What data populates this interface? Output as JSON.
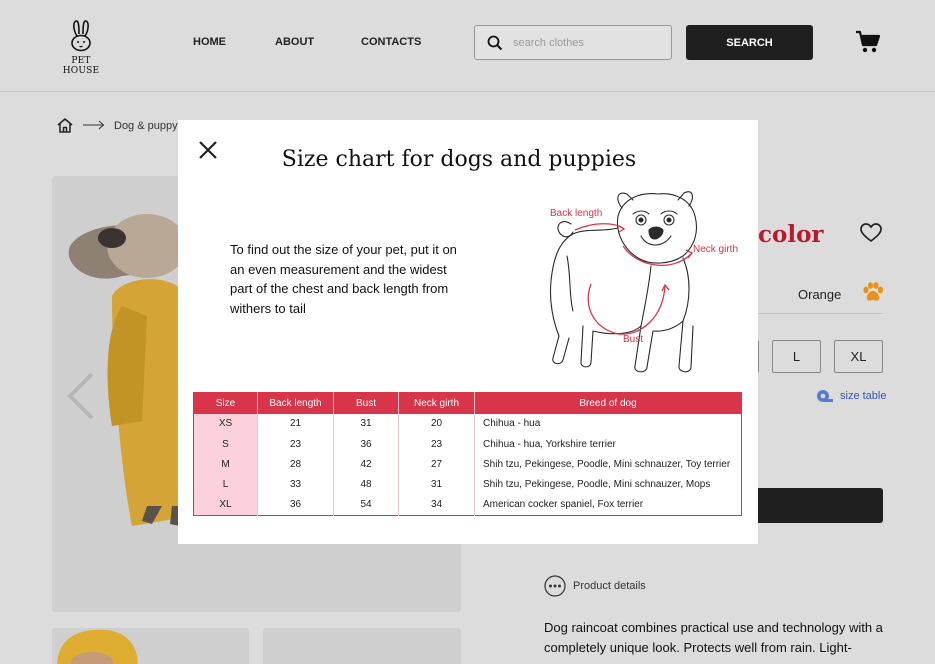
{
  "header": {
    "logo_text": "PET HOUSE",
    "nav": [
      "HOME",
      "ABOUT",
      "CONTACTS"
    ],
    "search_placeholder": "search clothes",
    "search_button": "SEARCH"
  },
  "breadcrumb": {
    "current": "Dog & puppy"
  },
  "product": {
    "color_title_fragment": "color",
    "color_name": "Orange",
    "sizes": [
      "L",
      "XL"
    ],
    "size_table_link": "size table",
    "details_label": "Product details",
    "description": "Dog raincoat combines practical use and technology with a completely unique look. Protects well from rain. Light-"
  },
  "modal": {
    "title": "Size chart for dogs and puppies",
    "text": "To find out the size of your pet, put it on an even measurement and the widest part of the chest and back length from withers to tail",
    "diagram_labels": {
      "back": "Back length",
      "neck": "Neck girth",
      "bust": "Bust"
    },
    "table": {
      "headers": [
        "Size",
        "Back length",
        "Bust",
        "Neck girth",
        "Breed of dog"
      ],
      "rows": [
        [
          "XS",
          "21",
          "31",
          "20",
          "Chihua - hua"
        ],
        [
          "S",
          "23",
          "36",
          "23",
          "Chihua - hua, Yorkshire terrier"
        ],
        [
          "M",
          "28",
          "42",
          "27",
          "Shih tzu, Pekingese, Poodle, Mini schnauzer, Toy terrier"
        ],
        [
          "L",
          "33",
          "48",
          "31",
          "Shih tzu, Pekingese, Poodle, Mini schnauzer, Mops"
        ],
        [
          "XL",
          "36",
          "54",
          "34",
          "American cocker spaniel, Fox terrier"
        ]
      ]
    }
  },
  "colors": {
    "accent": "#d8344a",
    "title_red": "#b8192e",
    "dark": "#1f1f1f",
    "overlay_bg": "#dcdcdc"
  },
  "icons": [
    "rabbit-logo-icon",
    "search-icon",
    "cart-icon",
    "home-icon",
    "arrow-right-icon",
    "chevron-left-icon",
    "heart-icon",
    "paw-icon",
    "tape-measure-icon",
    "more-dots-icon",
    "close-icon"
  ]
}
